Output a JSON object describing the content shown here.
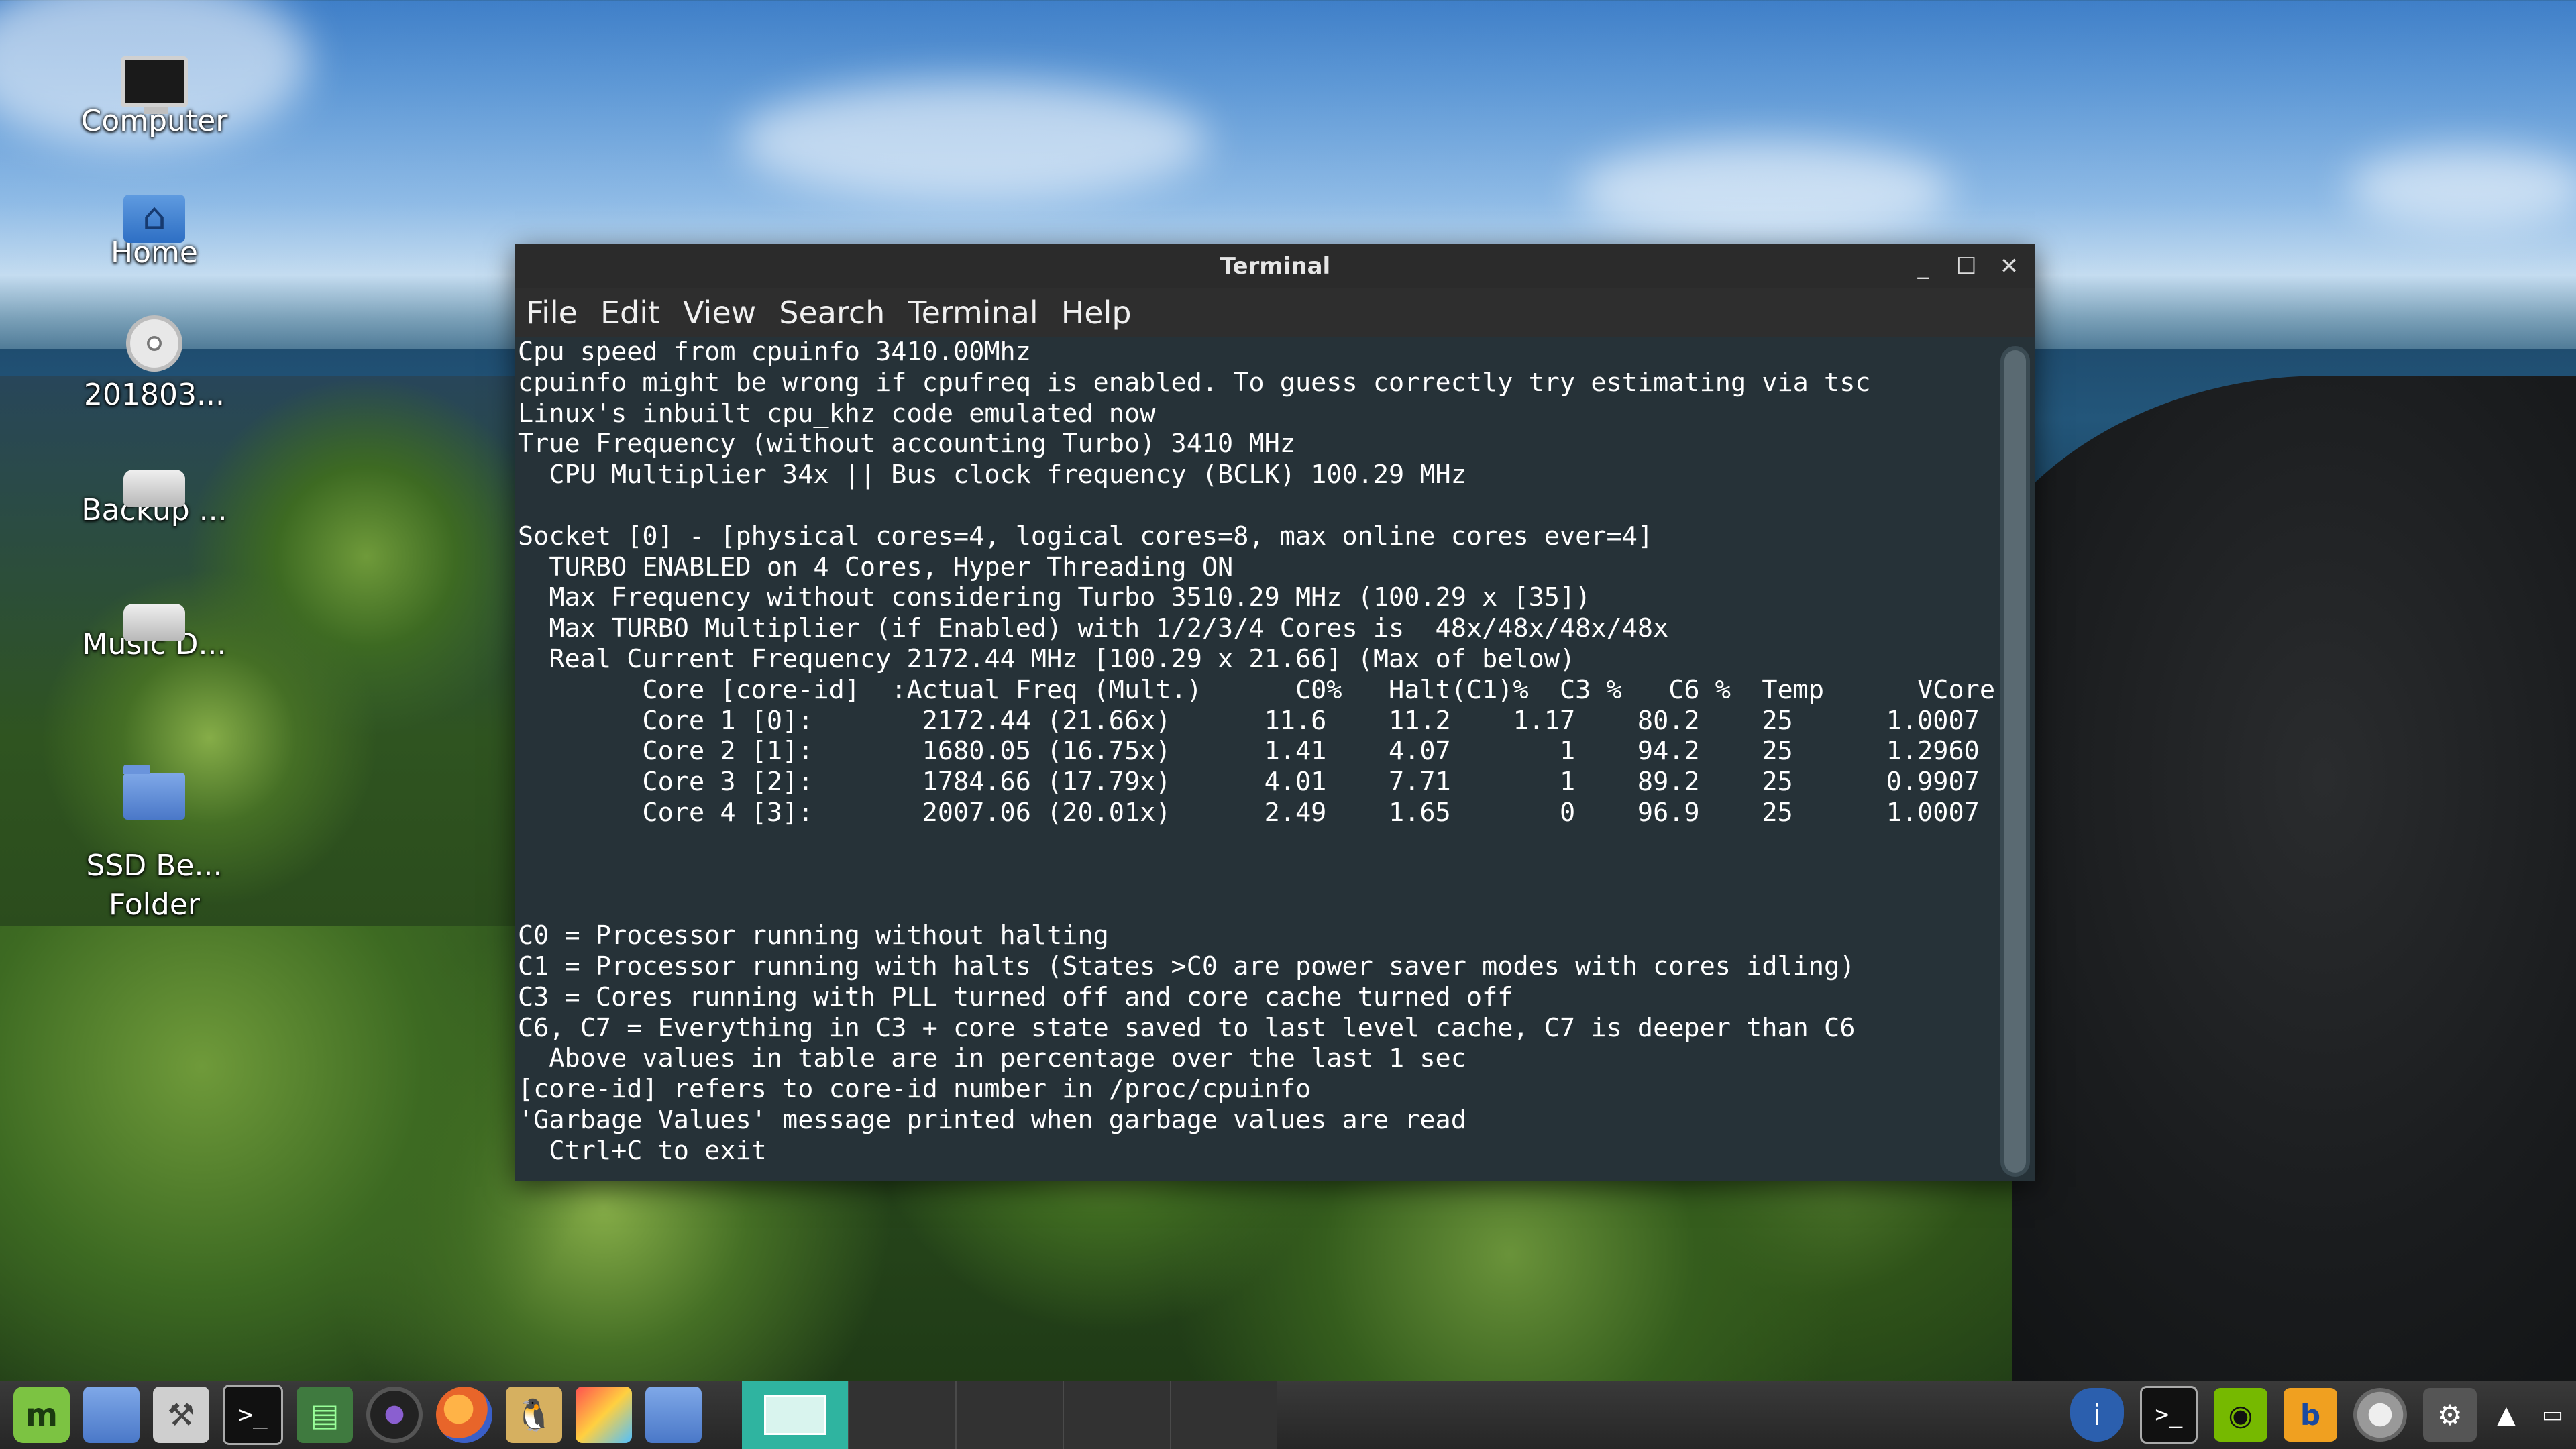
{
  "desktop": {
    "icons": [
      {
        "label": "Computer"
      },
      {
        "label": "Home"
      },
      {
        "label": "201803..."
      },
      {
        "label": "Backup ..."
      },
      {
        "label": "Music D..."
      },
      {
        "label": "SSD Be...\nFolder"
      }
    ]
  },
  "window": {
    "title": "Terminal",
    "controls": {
      "minimize": "_",
      "maximize": "☐",
      "close": "✕"
    },
    "menu": [
      "File",
      "Edit",
      "View",
      "Search",
      "Terminal",
      "Help"
    ],
    "output": "Cpu speed from cpuinfo 3410.00Mhz\ncpuinfo might be wrong if cpufreq is enabled. To guess correctly try estimating via tsc\nLinux's inbuilt cpu_khz code emulated now\nTrue Frequency (without accounting Turbo) 3410 MHz\n  CPU Multiplier 34x || Bus clock frequency (BCLK) 100.29 MHz\n\nSocket [0] - [physical cores=4, logical cores=8, max online cores ever=4]\n  TURBO ENABLED on 4 Cores, Hyper Threading ON\n  Max Frequency without considering Turbo 3510.29 MHz (100.29 x [35])\n  Max TURBO Multiplier (if Enabled) with 1/2/3/4 Cores is  48x/48x/48x/48x\n  Real Current Frequency 2172.44 MHz [100.29 x 21.66] (Max of below)\n        Core [core-id]  :Actual Freq (Mult.)      C0%   Halt(C1)%  C3 %   C6 %  Temp      VCore\n        Core 1 [0]:       2172.44 (21.66x)      11.6    11.2    1.17    80.2    25      1.0007\n        Core 2 [1]:       1680.05 (16.75x)      1.41    4.07       1    94.2    25      1.2960\n        Core 3 [2]:       1784.66 (17.79x)      4.01    7.71       1    89.2    25      0.9907\n        Core 4 [3]:       2007.06 (20.01x)      2.49    1.65       0    96.9    25      1.0007\n\n\n\nC0 = Processor running without halting\nC1 = Processor running with halts (States >C0 are power saver modes with cores idling)\nC3 = Cores running with PLL turned off and core cache turned off\nC6, C7 = Everything in C3 + core state saved to last level cache, C7 is deeper than C6\n  Above values in table are in percentage over the last 1 sec\n[core-id] refers to core-id number in /proc/cpuinfo\n'Garbage Values' message printed when garbage values are read\n  Ctrl+C to exit"
  },
  "taskbar": {
    "launchers": [
      {
        "name": "mint-menu",
        "glyph": "m"
      },
      {
        "name": "files",
        "glyph": ""
      },
      {
        "name": "tools",
        "glyph": "⚒"
      },
      {
        "name": "terminal",
        "glyph": ">_"
      },
      {
        "name": "system-monitor",
        "glyph": "▤"
      },
      {
        "name": "camera",
        "glyph": ""
      },
      {
        "name": "firefox",
        "glyph": ""
      },
      {
        "name": "tux",
        "glyph": "🐧"
      },
      {
        "name": "color-picker",
        "glyph": ""
      },
      {
        "name": "folder",
        "glyph": ""
      }
    ],
    "tray": [
      {
        "name": "shield",
        "glyph": "i"
      },
      {
        "name": "terminal",
        "glyph": ">_"
      },
      {
        "name": "nvidia",
        "glyph": "◉"
      },
      {
        "name": "b-app",
        "glyph": "b"
      },
      {
        "name": "disk",
        "glyph": ""
      },
      {
        "name": "settings",
        "glyph": "⚙"
      },
      {
        "name": "up-arrow",
        "glyph": "▲"
      },
      {
        "name": "display",
        "glyph": "▭"
      }
    ]
  }
}
